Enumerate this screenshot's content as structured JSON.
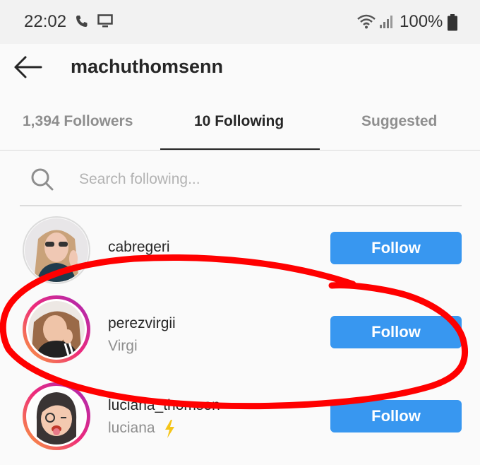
{
  "status_bar": {
    "time": "22:02",
    "battery_text": "100%"
  },
  "header": {
    "title": "machuthomsenn"
  },
  "tabs": [
    {
      "label": "1,394 Followers"
    },
    {
      "label": "10 Following"
    },
    {
      "label": "Suggested"
    }
  ],
  "search": {
    "placeholder": "Search following..."
  },
  "users": [
    {
      "username": "cabregeri",
      "name": "",
      "button": "Follow"
    },
    {
      "username": "perezvirgii",
      "name": "Virgi",
      "button": "Follow"
    },
    {
      "username": "luciana_thomsen",
      "name": "luciana",
      "button": "Follow"
    }
  ],
  "colors": {
    "accent": "#3897f0",
    "annotation": "#ff0000"
  },
  "icons": [
    "phone-icon",
    "monitor-icon",
    "wifi-icon",
    "signal-icon",
    "battery-icon",
    "back-arrow-icon",
    "search-icon",
    "lightning-icon"
  ]
}
